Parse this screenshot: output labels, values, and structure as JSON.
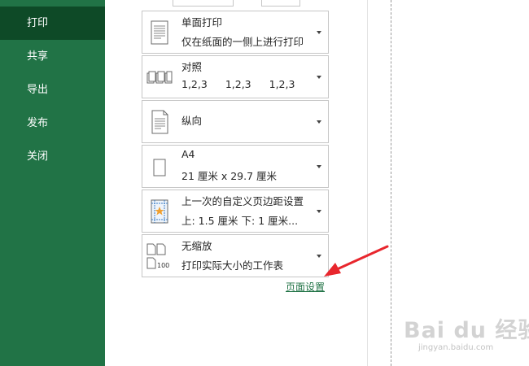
{
  "sidebar": {
    "items": [
      {
        "label": "打印",
        "active": true
      },
      {
        "label": "共享"
      },
      {
        "label": "导出"
      },
      {
        "label": "发布"
      },
      {
        "label": "关闭"
      }
    ]
  },
  "settings": {
    "sides": {
      "title": "单面打印",
      "subtitle": "仅在纸面的一侧上进行打印"
    },
    "collate": {
      "title": "对照",
      "values": [
        "1,2,3",
        "1,2,3",
        "1,2,3"
      ]
    },
    "orientation": {
      "title": "纵向"
    },
    "paper": {
      "title": "A4",
      "subtitle": "21 厘米 x 29.7 厘米"
    },
    "margins": {
      "title": "上一次的自定义页边距设置",
      "subtitle": "上: 1.5 厘米 下: 1 厘米..."
    },
    "scaling": {
      "title": "无缩放",
      "subtitle": "打印实际大小的工作表",
      "icon_number": "100"
    }
  },
  "page_setup_label": "页面设置",
  "watermark": {
    "text": "Bai du 经验",
    "sub": "jingyan.baidu.com"
  },
  "colors": {
    "sidebar": "#217346",
    "sidebar_active": "#0e4a27",
    "link": "#217346",
    "annotation": "#e8262d"
  }
}
